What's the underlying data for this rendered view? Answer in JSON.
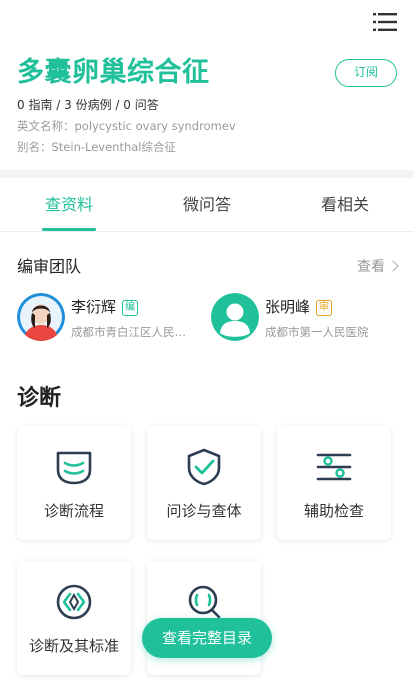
{
  "header": {
    "menu_icon": "menu-icon"
  },
  "topic": {
    "title": "多囊卵巢综合征",
    "subscribe_label": "订阅",
    "stats": "0 指南 / 3 份病例 / 0 问答",
    "english_name": "英文名称：polycystic ovary syndromev",
    "alias": "别名：Stein-Leventhal综合征"
  },
  "tabs": [
    {
      "label": "查资料",
      "active": true
    },
    {
      "label": "微问答",
      "active": false
    },
    {
      "label": "看相关",
      "active": false
    }
  ],
  "team": {
    "title": "编审团队",
    "view_label": "查看",
    "members": [
      {
        "name": "李衍辉",
        "badge": "编",
        "hospital": "成都市青白江区人民医院"
      },
      {
        "name": "张明峰",
        "badge": "审",
        "hospital": "成都市第一人民医院"
      }
    ]
  },
  "diagnosis": {
    "title": "诊断",
    "cards": [
      {
        "label": "诊断流程",
        "icon": "flow-icon"
      },
      {
        "label": "问诊与查体",
        "icon": "shield-check-icon"
      },
      {
        "label": "辅助检查",
        "icon": "sliders-icon"
      },
      {
        "label": "诊断及其标准",
        "icon": "standard-icon"
      },
      {
        "label": "",
        "icon": "magnifier-icon"
      }
    ]
  },
  "fab": {
    "label": "查看完整目录"
  },
  "colors": {
    "accent": "#1fc09a",
    "review": "#e3a520",
    "icon_dark": "#2c3e50"
  }
}
